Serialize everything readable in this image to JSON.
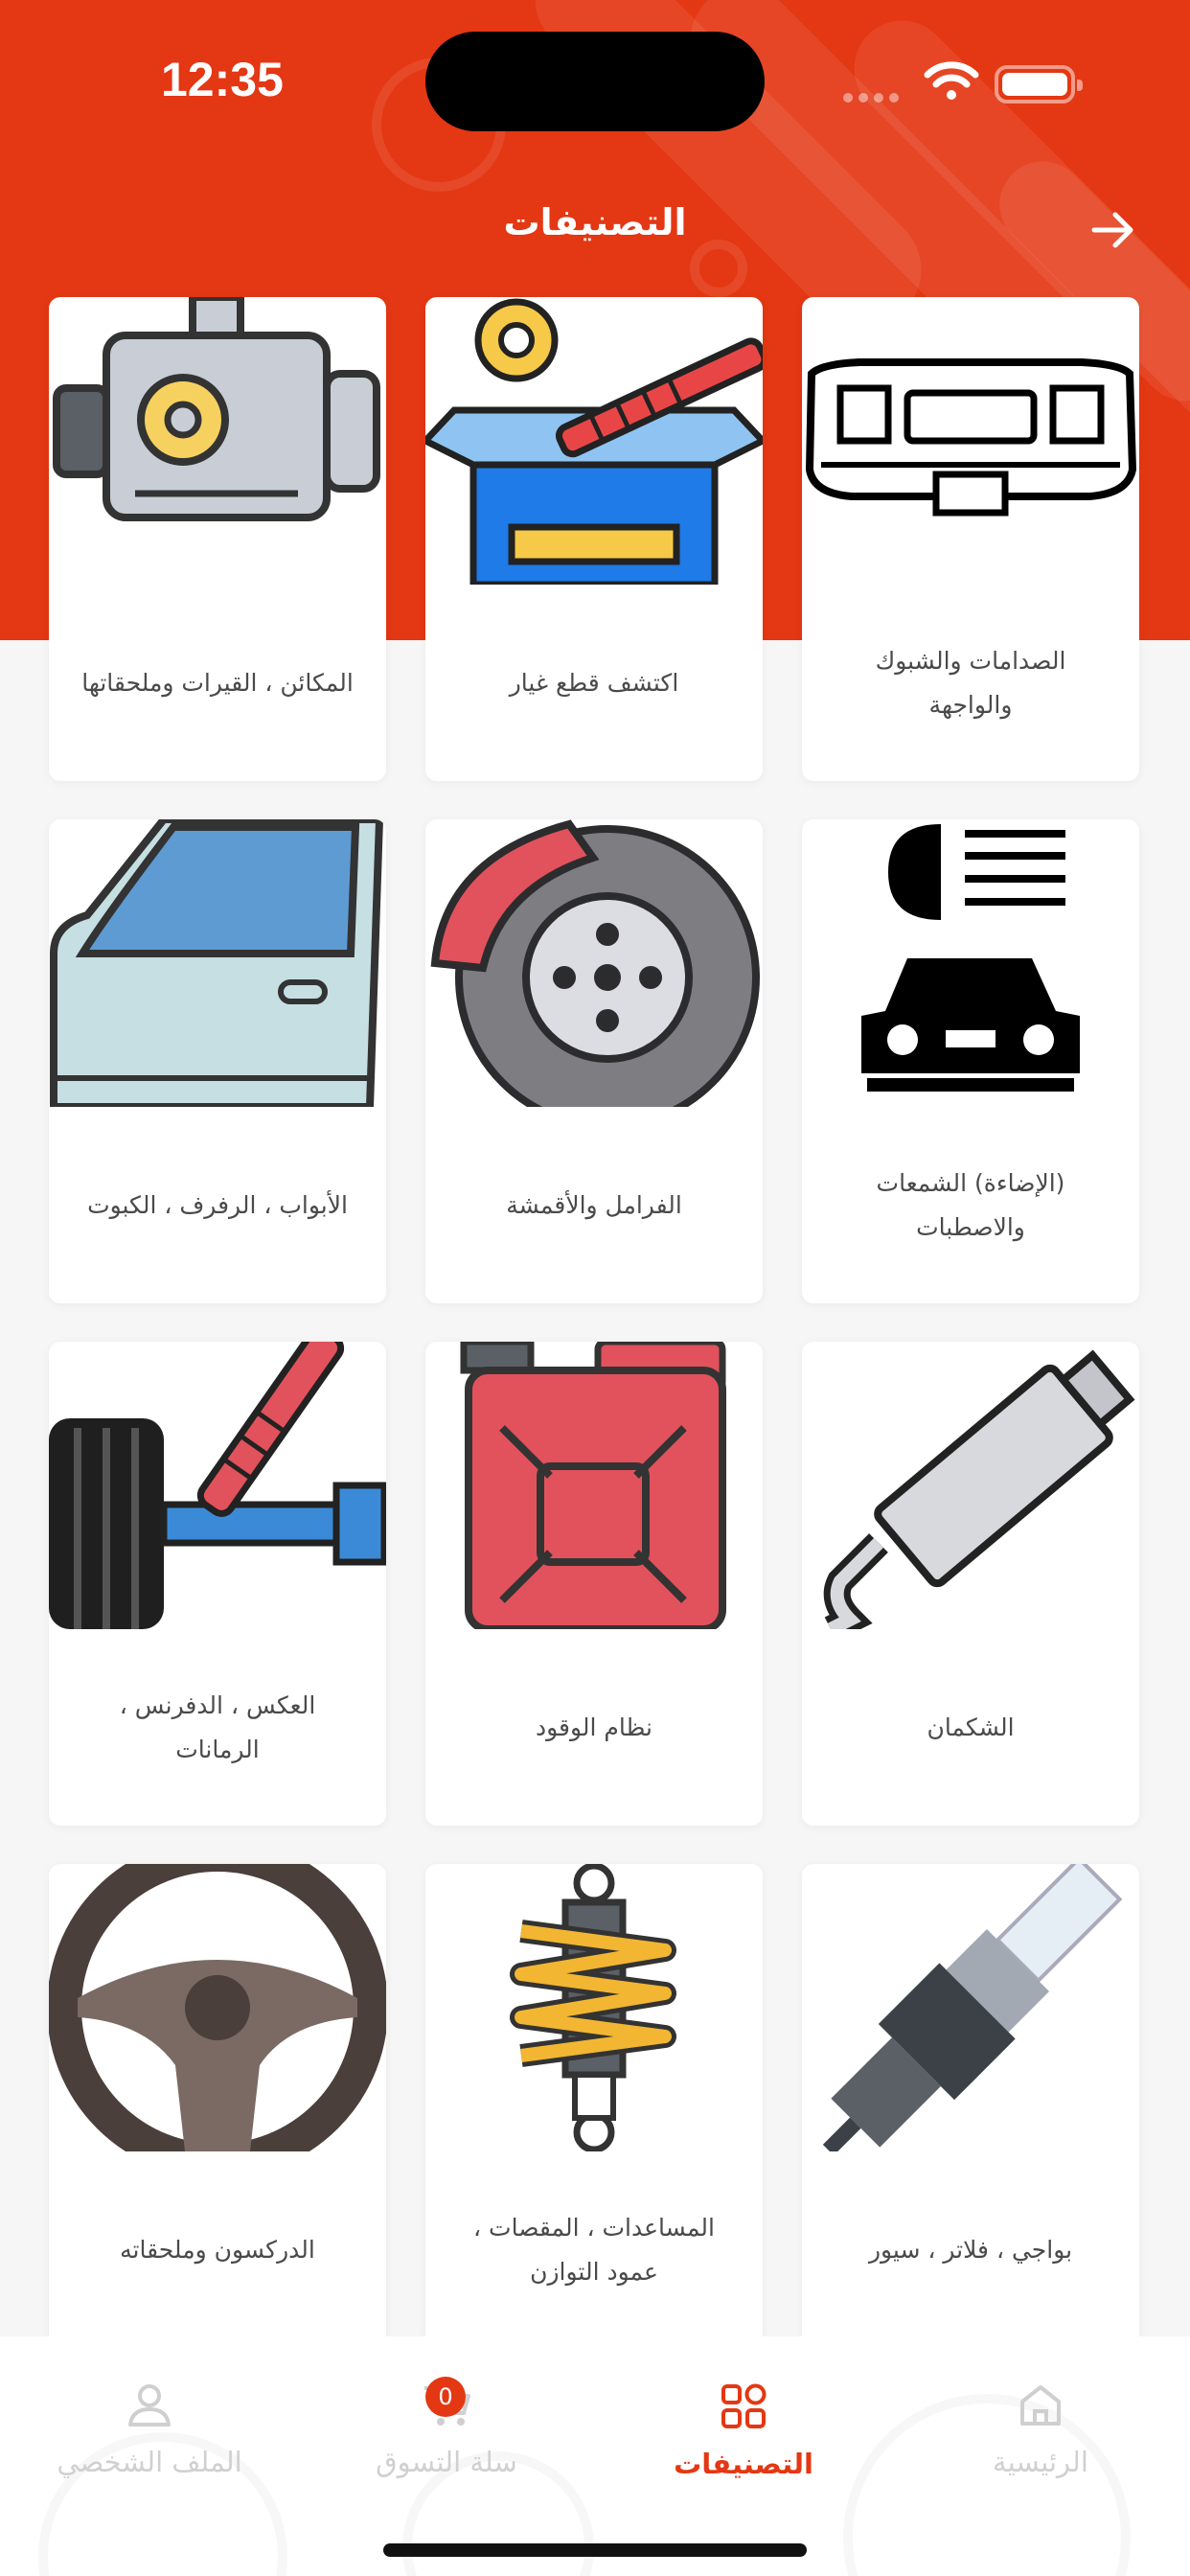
{
  "status_bar": {
    "time": "12:35"
  },
  "header": {
    "title": "التصنيفات"
  },
  "categories": [
    {
      "label": "الصدامات والشبوك والواجهة",
      "icon": "car-bumper-icon"
    },
    {
      "label": "اكتشف قطع غيار",
      "icon": "parts-box-icon"
    },
    {
      "label": "المكائن ، القيرات وملحقاتها",
      "icon": "engine-icon"
    },
    {
      "label": "(الإضاءة) الشمعات والاصطبات",
      "icon": "car-headlight-icon"
    },
    {
      "label": "الفرامل والأقمشة",
      "icon": "brake-disc-icon"
    },
    {
      "label": "الأبواب ، الرفرف ، الكبوت",
      "icon": "car-door-icon"
    },
    {
      "label": "الشكمان",
      "icon": "exhaust-muffler-icon"
    },
    {
      "label": "نظام الوقود",
      "icon": "fuel-can-icon"
    },
    {
      "label": "العكس ، الدفرنس ، الرمانات",
      "icon": "suspension-axle-icon"
    },
    {
      "label": "بواجي ، فلاتر ، سيور",
      "icon": "spark-plug-icon"
    },
    {
      "label": "المساعدات ، المقصات ، عمود التوازن",
      "icon": "shock-absorber-icon"
    },
    {
      "label": "الدركسون وملحقاته",
      "icon": "steering-wheel-icon"
    }
  ],
  "tabbar": {
    "home": "الرئيسية",
    "categories": "التصنيفات",
    "cart": "سلة التسوق",
    "cart_count": "0",
    "profile": "الملف الشخصي"
  },
  "colors": {
    "accent": "#e43713",
    "card": "#ffffff",
    "background": "#f6f6f6"
  }
}
